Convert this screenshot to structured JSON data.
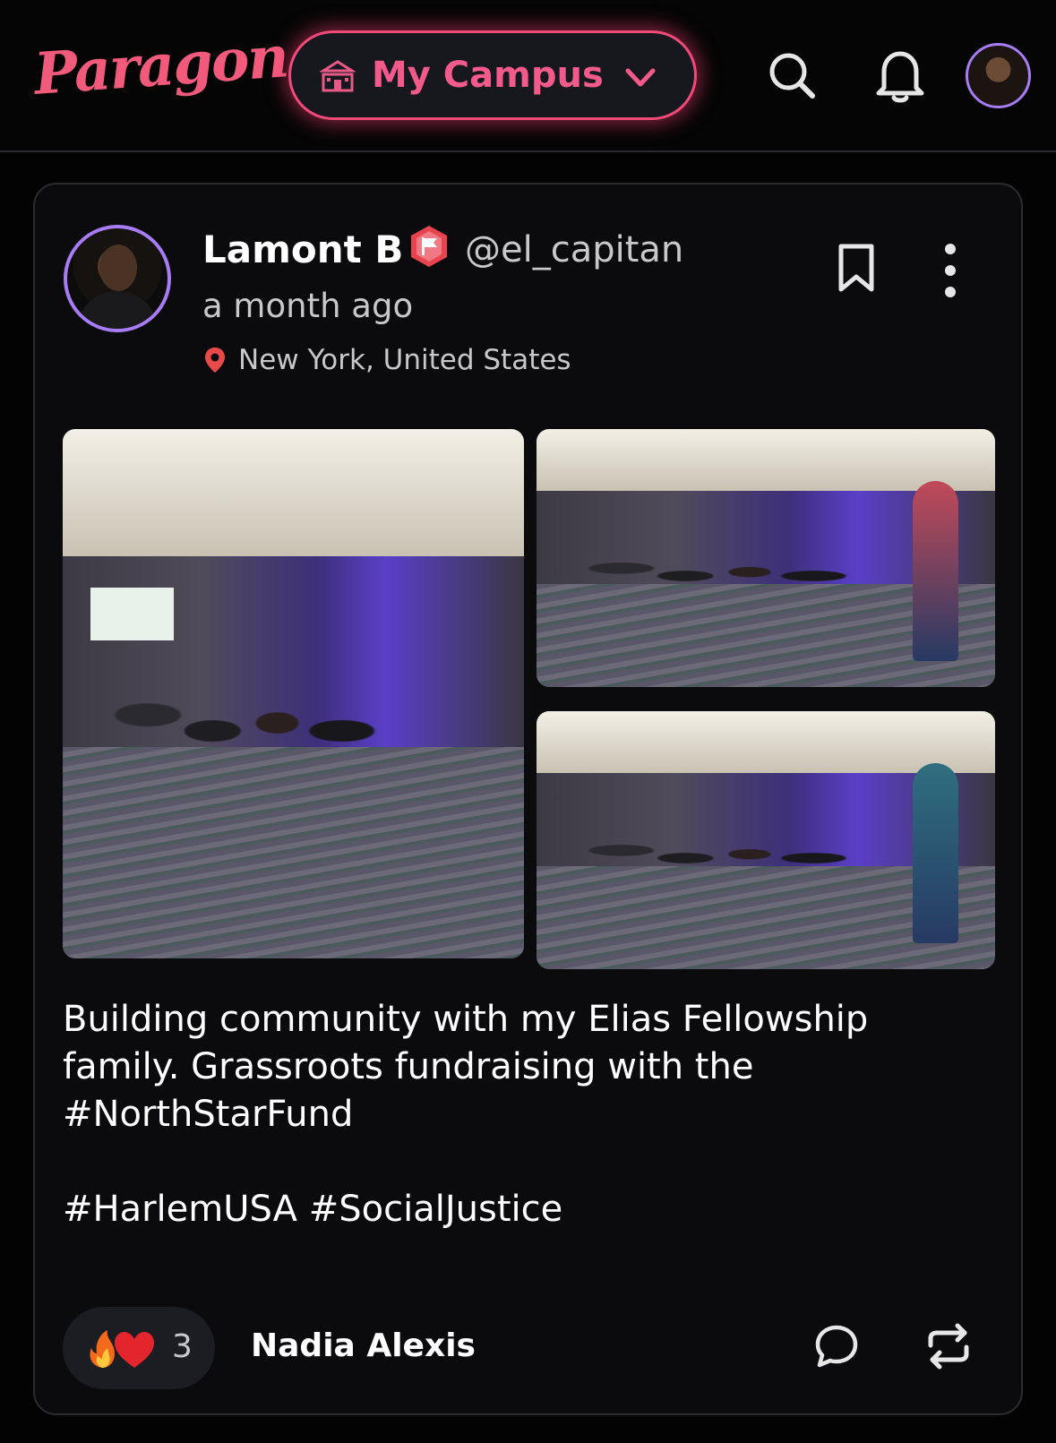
{
  "header": {
    "logo_text": "Paragon",
    "campus_button_label": "My Campus",
    "icons": [
      "school-icon",
      "chevron-down-icon",
      "search-icon",
      "bell-icon",
      "avatar"
    ]
  },
  "post": {
    "author_name": "Lamont B",
    "author_handle": "@el_capitan",
    "timestamp": "a month ago",
    "location": "New York, United States",
    "photo_count": 3,
    "body": "Building community with my Elias Fellowship family. Grassroots fundraising with the #NorthStarFund\n\n#HarlemUSA #SocialJustice",
    "reactions": {
      "emojis": [
        "fire",
        "heart"
      ],
      "count": "3",
      "top_reactor": "Nadia Alexis"
    }
  },
  "colors": {
    "accent": "#f25a7c",
    "avatar_ring": "#a77cf4",
    "background": "#030303",
    "card": "#0b0b0d",
    "badge": "#e8434f"
  }
}
